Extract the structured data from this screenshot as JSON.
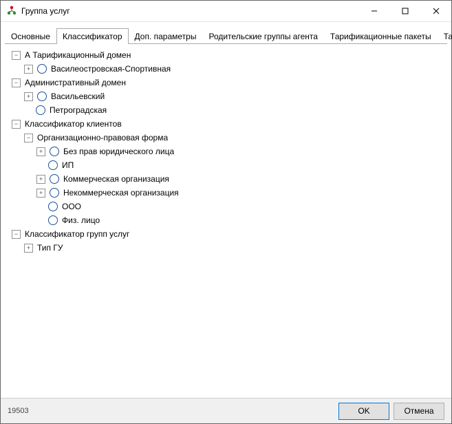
{
  "window": {
    "title": "Группа услуг"
  },
  "tabs": {
    "items": [
      "Основные",
      "Классификатор",
      "Доп. параметры",
      "Родительские группы агента",
      "Тарификационные пакеты",
      "Тари"
    ],
    "active_index": 1
  },
  "tree": [
    {
      "depth": 0,
      "expander": "minus",
      "radio": false,
      "label": "А Тарификационный домен"
    },
    {
      "depth": 1,
      "expander": "plus",
      "radio": true,
      "label": "Василеостровская-Спортивная"
    },
    {
      "depth": 0,
      "expander": "minus",
      "radio": false,
      "label": "Административный домен"
    },
    {
      "depth": 1,
      "expander": "plus",
      "radio": true,
      "label": "Васильевский"
    },
    {
      "depth": 1,
      "expander": "none",
      "radio": true,
      "label": "Петроградская"
    },
    {
      "depth": 0,
      "expander": "minus",
      "radio": false,
      "label": "Классификатор клиентов"
    },
    {
      "depth": 1,
      "expander": "minus",
      "radio": false,
      "label": "Организационно-правовая форма"
    },
    {
      "depth": 2,
      "expander": "plus",
      "radio": true,
      "label": "Без прав юридического лица"
    },
    {
      "depth": 2,
      "expander": "none",
      "radio": true,
      "label": "ИП"
    },
    {
      "depth": 2,
      "expander": "plus",
      "radio": true,
      "label": "Коммерческая организация"
    },
    {
      "depth": 2,
      "expander": "plus",
      "radio": true,
      "label": "Некоммерческая организация"
    },
    {
      "depth": 2,
      "expander": "none",
      "radio": true,
      "label": "ООО"
    },
    {
      "depth": 2,
      "expander": "none",
      "radio": true,
      "label": "Физ. лицо"
    },
    {
      "depth": 0,
      "expander": "minus",
      "radio": false,
      "label": "Классификатор групп услуг"
    },
    {
      "depth": 1,
      "expander": "plus",
      "radio": false,
      "label": "Тип ГУ"
    }
  ],
  "footer": {
    "id": "19503",
    "ok": "OK",
    "cancel": "Отмена"
  },
  "scroll": {
    "left": "◂",
    "right": "▸"
  }
}
